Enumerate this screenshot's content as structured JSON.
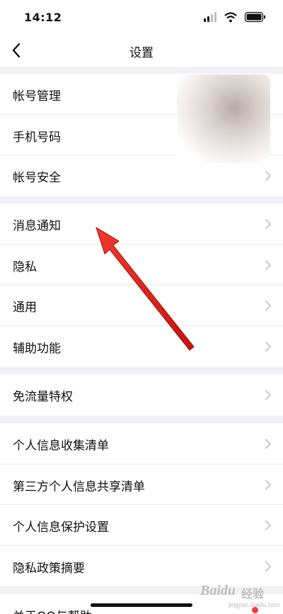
{
  "status_bar": {
    "time": "14:12"
  },
  "nav": {
    "title": "设置"
  },
  "groups": [
    {
      "items": [
        {
          "label": "帐号管理"
        },
        {
          "label": "手机号码"
        },
        {
          "label": "帐号安全"
        }
      ]
    },
    {
      "items": [
        {
          "label": "消息通知"
        },
        {
          "label": "隐私"
        },
        {
          "label": "通用"
        },
        {
          "label": "辅助功能"
        }
      ]
    },
    {
      "items": [
        {
          "label": "免流量特权"
        }
      ]
    },
    {
      "items": [
        {
          "label": "个人信息收集清单"
        },
        {
          "label": "第三方个人信息共享清单"
        },
        {
          "label": "个人信息保护设置"
        },
        {
          "label": "隐私政策摘要"
        }
      ]
    },
    {
      "items": [
        {
          "label": "关于QQ与帮助"
        }
      ]
    }
  ],
  "watermark": {
    "brand": "Baidu",
    "cn": "经验",
    "url": "jingyan.baidu.com"
  },
  "colors": {
    "accent_arrow": "#e3201b",
    "background": "#f2f2f6",
    "row_bg": "#ffffff",
    "chevron": "#c4c4c8"
  }
}
